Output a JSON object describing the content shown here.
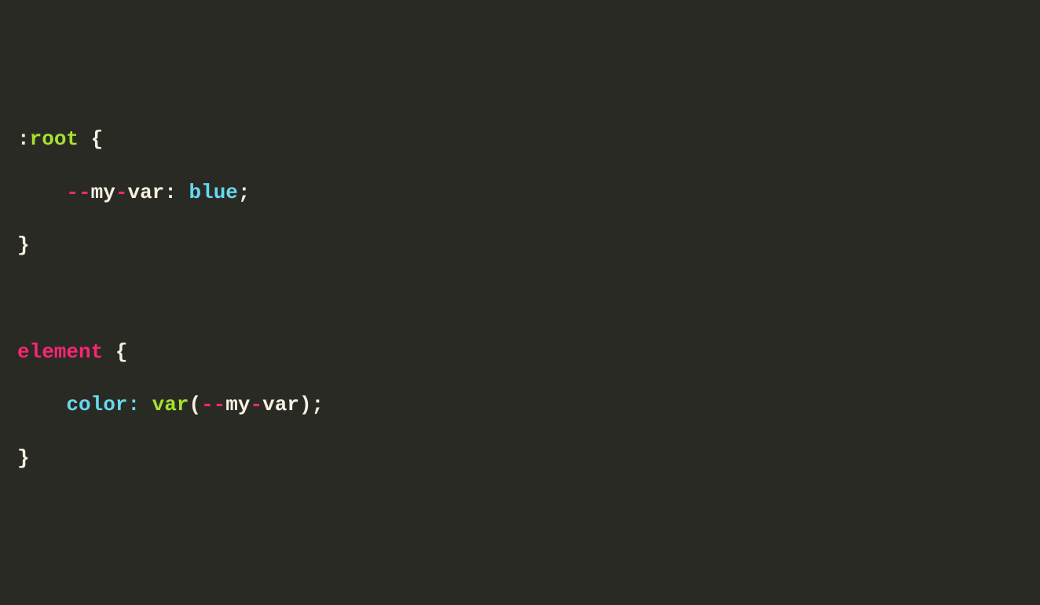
{
  "code": {
    "line1": {
      "colon": ":",
      "root": "root",
      "brace_open": " {"
    },
    "line2": {
      "indent": "    ",
      "dash1": "--",
      "my": "my",
      "dash2": "-",
      "var_word": "var",
      "colon_sep": ":",
      "space": " ",
      "value": "blue",
      "semi": ";"
    },
    "line3": {
      "brace_close": "}"
    },
    "line5": {
      "element": "element",
      "brace_open": " {"
    },
    "line6": {
      "indent": "    ",
      "property": "color",
      "colon_sep": ":",
      "space": " ",
      "fn": "var",
      "po": "(",
      "dash1": "--",
      "my": "my",
      "dash2": "-",
      "var_word": "var",
      "pc": ")",
      "semi": ";"
    },
    "line7": {
      "brace_close": "}"
    }
  }
}
